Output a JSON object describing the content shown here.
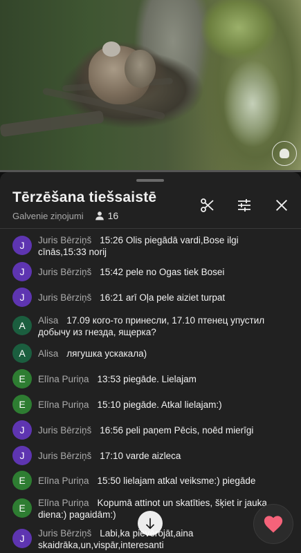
{
  "header": {
    "title": "Tērzēšana tiešsaistē",
    "mode_label": "Galvenie ziņojumi",
    "viewer_count": "16"
  },
  "icons": {
    "scissors": "scissors-icon",
    "filter": "tune-icon",
    "close": "close-icon",
    "viewers": "person-icon",
    "scroll_down": "arrow-down-icon",
    "like": "heart-icon"
  },
  "colors": {
    "avatar_purple": "#5e35b1",
    "avatar_green": "#2e7d32",
    "avatar_teal": "#1b5e3f",
    "heart": "#f5637a"
  },
  "messages": [
    {
      "initial": "J",
      "author": "Juris Bērziņš",
      "text": "15:26 Olis piegādā vardi,Bose ilgi cīnās,15:33 norij",
      "color": "#5e35b1"
    },
    {
      "initial": "J",
      "author": "Juris Bērziņš",
      "text": "15:42 pele no Ogas tiek Bosei",
      "color": "#5e35b1"
    },
    {
      "initial": "J",
      "author": "Juris Bērziņš",
      "text": "16:21 arī Oļa pele aiziet turpat",
      "color": "#5e35b1"
    },
    {
      "initial": "A",
      "author": "Alisa",
      "text": "17.09 кого-то принесли, 17.10 птенец упустил добычу из гнезда, ящерка?",
      "color": "#1b5e3f"
    },
    {
      "initial": "A",
      "author": "Alisa",
      "text": "лягушка ускакала)",
      "color": "#1b5e3f"
    },
    {
      "initial": "E",
      "author": "Elīna Puriņa",
      "text": "13:53 piegāde. Lielajam",
      "color": "#2e7d32"
    },
    {
      "initial": "E",
      "author": "Elīna Puriņa",
      "text": "15:10 piegāde. Atkal lielajam:)",
      "color": "#2e7d32"
    },
    {
      "initial": "J",
      "author": "Juris Bērziņš",
      "text": "16:56 peli paņem Pēcis, noēd mierīgi",
      "color": "#5e35b1"
    },
    {
      "initial": "J",
      "author": "Juris Bērziņš",
      "text": "17:10 varde aizleca",
      "color": "#5e35b1"
    },
    {
      "initial": "E",
      "author": "Elīna Puriņa",
      "text": "15:50 lielajam atkal veiksme:) piegāde",
      "color": "#2e7d32"
    },
    {
      "initial": "E",
      "author": "Elīna Puriņa",
      "text": "Kopumā attinot un skatīties, šķiet ir jauka diena:) pagaidām:)",
      "color": "#2e7d32"
    },
    {
      "initial": "J",
      "author": "Juris Bērziņš",
      "text": "Labi,ka pievērojāt,aina skaidrāka,un,vispār,interesanti",
      "color": "#5e35b1"
    }
  ]
}
